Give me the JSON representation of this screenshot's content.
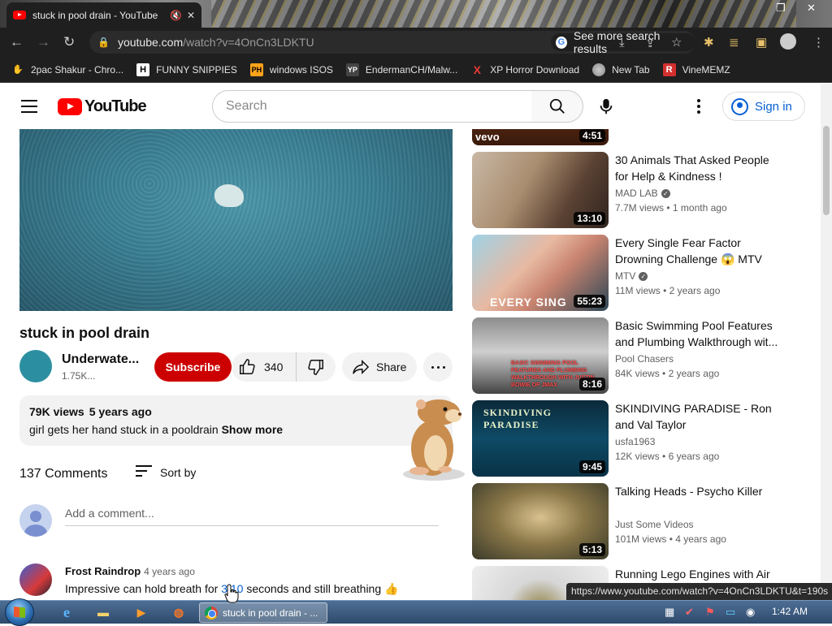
{
  "browser": {
    "tab_title": "stuck in pool drain - YouTube",
    "url_host": "youtube.com",
    "url_path": "/watch?v=4OnCn3LDKTU",
    "see_more": "See more search results",
    "bookmarks": [
      {
        "label": "2pac Shakur - Chro...",
        "icon": "hand-icon",
        "color": "#c9a06a"
      },
      {
        "label": "FUNNY SNIPPIES",
        "icon": "H",
        "color": "#ffffff"
      },
      {
        "label": "windows ISOS",
        "icon": "PH",
        "color": "#ffa31a"
      },
      {
        "label": "EndermanCH/Malw...",
        "icon": "YP",
        "color": "#444444"
      },
      {
        "label": "XP Horror Download",
        "icon": "X",
        "color": "#e53935"
      },
      {
        "label": "New Tab",
        "icon": "chrome-icon",
        "color": "#e0e0e0"
      },
      {
        "label": "VineMEMZ",
        "icon": "R",
        "color": "#d32f2f"
      }
    ],
    "status_url": "https://www.youtube.com/watch?v=4OnCn3LDKTU&t=190s"
  },
  "header": {
    "logo": "YouTube",
    "search_placeholder": "Search",
    "signin": "Sign in"
  },
  "video": {
    "title": "stuck in pool drain",
    "channel": "Underwate...",
    "subscribers": "1.75K...",
    "subscribe": "Subscribe",
    "likes": "340",
    "share": "Share",
    "views": "79K views",
    "age": "5 years ago",
    "description": "girl gets her hand stuck in a pooldrain",
    "show_more": "Show more"
  },
  "comments": {
    "count": "137 Comments",
    "sort": "Sort by",
    "add_placeholder": "Add a comment...",
    "items": [
      {
        "author": "Frost Raindrop",
        "age": "4 years ago",
        "text_before": "Impressive can hold breath for ",
        "timestamp": "3:10",
        "text_after": " seconds and still breathing 👍"
      }
    ]
  },
  "recommendations": [
    {
      "title": "",
      "channel": "",
      "meta": "",
      "duration": "4:51",
      "badge": "vevo"
    },
    {
      "title": "30 Animals That Asked People for Help & Kindness !",
      "channel": "MAD LAB",
      "verified": true,
      "views": "7.7M views",
      "age": "1 month ago",
      "duration": "13:10"
    },
    {
      "title": "Every Single Fear Factor Drowning Challenge 😱 MTV",
      "channel": "MTV",
      "verified": true,
      "views": "11M views",
      "age": "2 years ago",
      "duration": "55:23",
      "overlay": "EVERY SING"
    },
    {
      "title": "Basic Swimming Pool Features and Plumbing Walkthrough wit...",
      "channel": "Pool Chasers",
      "verified": false,
      "views": "84K views",
      "age": "2 years ago",
      "duration": "8:16",
      "overlay": "BASIC SWIMMING POOL FEATURES AND PLUMBING WALKTHROUGH WITH JUSTIN BOWIE OF JMAX"
    },
    {
      "title": "SKINDIVING PARADISE - Ron and Val Taylor",
      "channel": "usfa1963",
      "verified": false,
      "views": "12K views",
      "age": "6 years ago",
      "duration": "9:45",
      "overlay": "SKINDIVING PARADISE"
    },
    {
      "title": "Talking Heads - Psycho Killer",
      "channel": "Just Some Videos",
      "verified": false,
      "views": "101M views",
      "age": "4 years ago",
      "duration": "5:13"
    },
    {
      "title": "Running Lego Engines with Air",
      "channel": "",
      "verified": false,
      "views": "",
      "age": "",
      "duration": ""
    }
  ],
  "taskbar": {
    "task_label": "stuck in pool drain - ...",
    "clock": "1:42 AM"
  }
}
